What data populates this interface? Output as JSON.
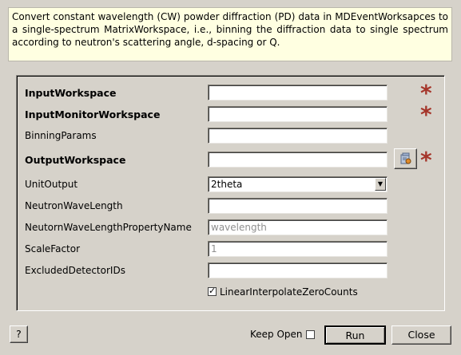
{
  "description": "Convert constant wavelength (CW) powder diffraction (PD) data in MDEventWorksapces to a single-spectrum MatrixWorkspace, i.e., binning the diffraction data to single spectrum according to neutron's scattering angle, d-spacing or Q.",
  "fields": {
    "input_workspace": {
      "label": "InputWorkspace",
      "value": "",
      "required_mark": "*"
    },
    "input_monitor_workspace": {
      "label": "InputMonitorWorkspace",
      "value": "",
      "required_mark": "*"
    },
    "binning_params": {
      "label": "BinningParams",
      "value": ""
    },
    "output_workspace": {
      "label": "OutputWorkspace",
      "value": "",
      "required_mark": "*"
    },
    "unit_output": {
      "label": "UnitOutput",
      "value": "2theta",
      "arrow": "▼"
    },
    "neutron_wavelength": {
      "label": "NeutronWaveLength",
      "value": ""
    },
    "wavelength_property_name": {
      "label": "NeutornWaveLengthPropertyName",
      "placeholder": "wavelength"
    },
    "scale_factor": {
      "label": "ScaleFactor",
      "placeholder": "1"
    },
    "excluded_detector_ids": {
      "label": "ExcludedDetectorIDs",
      "value": ""
    },
    "linear_interpolate": {
      "label": "LinearInterpolateZeroCounts",
      "checked": true,
      "mark": "✓"
    }
  },
  "footer": {
    "help_label": "?",
    "keep_open_label": "Keep Open",
    "run_label": "Run",
    "close_label": "Close"
  },
  "icons": {
    "browse": "folder-browse-icon"
  }
}
